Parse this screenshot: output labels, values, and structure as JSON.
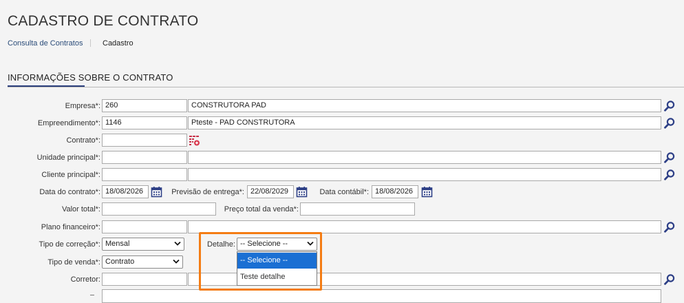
{
  "page": {
    "title": "CADASTRO DE CONTRATO",
    "breadcrumb": {
      "link": "Consulta de Contratos",
      "current": "Cadastro"
    },
    "section_title": "INFORMAÇÕES SOBRE O CONTRATO"
  },
  "form": {
    "empresa": {
      "label": "Empresa*:",
      "code": "260",
      "name": "CONSTRUTORA PAD"
    },
    "empreendimento": {
      "label": "Empreendimento*:",
      "code": "1146",
      "name": "Pteste - PAD CONSTRUTORA"
    },
    "contrato": {
      "label": "Contrato*:",
      "value": ""
    },
    "unidade_principal": {
      "label": "Unidade principal*:",
      "code": "",
      "name": ""
    },
    "cliente_principal": {
      "label": "Cliente principal*:",
      "code": "",
      "name": ""
    },
    "data_contrato": {
      "label": "Data do contrato*:",
      "value": "18/08/2026"
    },
    "previsao_entrega": {
      "label": "Previsão de entrega*:",
      "value": "22/08/2029"
    },
    "data_contabil": {
      "label": "Data contábil*:",
      "value": "18/08/2026"
    },
    "valor_total": {
      "label": "Valor total*:",
      "value": ""
    },
    "preco_total_venda": {
      "label": "Preço total da venda*:",
      "value": ""
    },
    "plano_financeiro": {
      "label": "Plano financeiro*:",
      "code": "",
      "name": ""
    },
    "tipo_correcao": {
      "label": "Tipo de correção*:",
      "value": "Mensal"
    },
    "detalhe": {
      "label": "Detalhe:",
      "value": "-- Selecione --",
      "options": [
        "-- Selecione --",
        "Teste detalhe"
      ],
      "selected_index": 0
    },
    "tipo_venda": {
      "label": "Tipo de venda*:",
      "value": "Contrato"
    },
    "corretor": {
      "label": "Corretor:",
      "code": "",
      "name": ""
    }
  },
  "colors": {
    "accent": "#2b3f7c",
    "highlight": "#f47c13",
    "selection": "#1a6fd3"
  },
  "icons": {
    "lookup": "magnifier-icon",
    "calendar": "calendar-icon",
    "generate": "generate-number-icon",
    "dropdown": "chevron-down-icon"
  }
}
